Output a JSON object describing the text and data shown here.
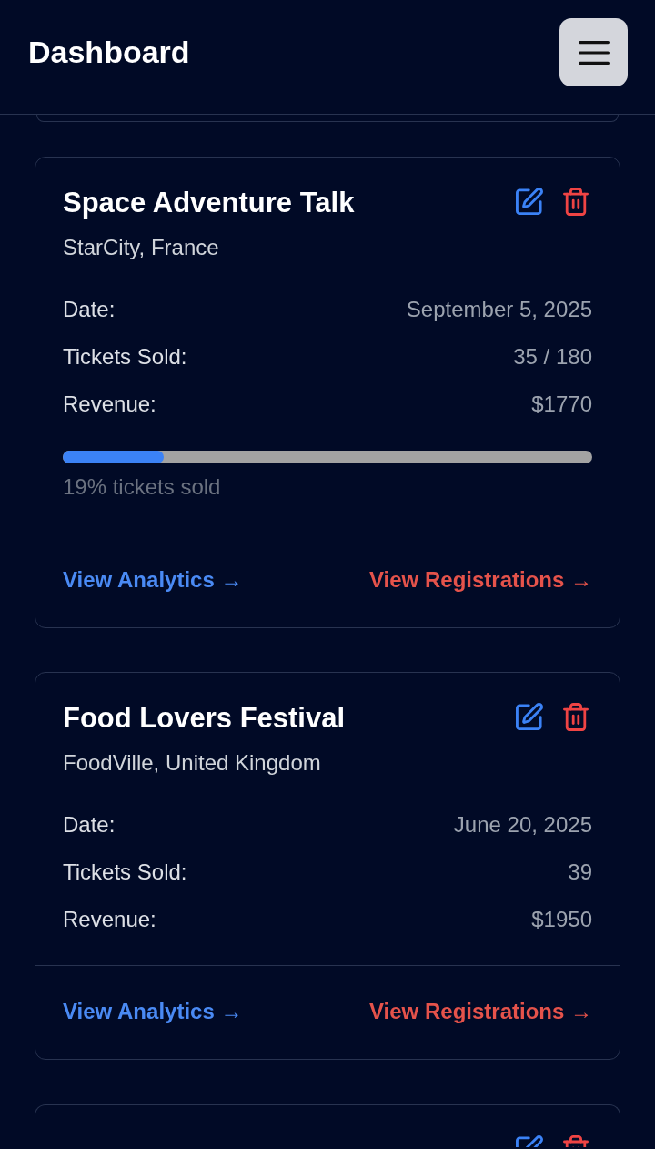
{
  "header": {
    "title": "Dashboard"
  },
  "events": [
    {
      "title": "Space Adventure Talk",
      "location": "StarCity, France",
      "details": [
        {
          "label": "Date:",
          "value": "September 5, 2025"
        },
        {
          "label": "Tickets Sold:",
          "value": "35 / 180"
        },
        {
          "label": "Revenue:",
          "value": "$1770"
        }
      ],
      "progress": {
        "level": 0.19,
        "caption": "19% tickets sold"
      },
      "links": [
        {
          "kind": "analytics",
          "label": "View Analytics →"
        },
        {
          "kind": "registrations",
          "label": "View Registrations →"
        }
      ]
    },
    {
      "title": "Food Lovers Festival",
      "location": "FoodVille, United Kingdom",
      "details": [
        {
          "label": "Date:",
          "value": "June 20, 2025"
        },
        {
          "label": "Tickets Sold:",
          "value": "39"
        },
        {
          "label": "Revenue:",
          "value": "$1950"
        }
      ],
      "links": [
        {
          "kind": "analytics",
          "label": "View Analytics →"
        },
        {
          "kind": "registrations",
          "label": "View Registrations →"
        }
      ]
    }
  ]
}
